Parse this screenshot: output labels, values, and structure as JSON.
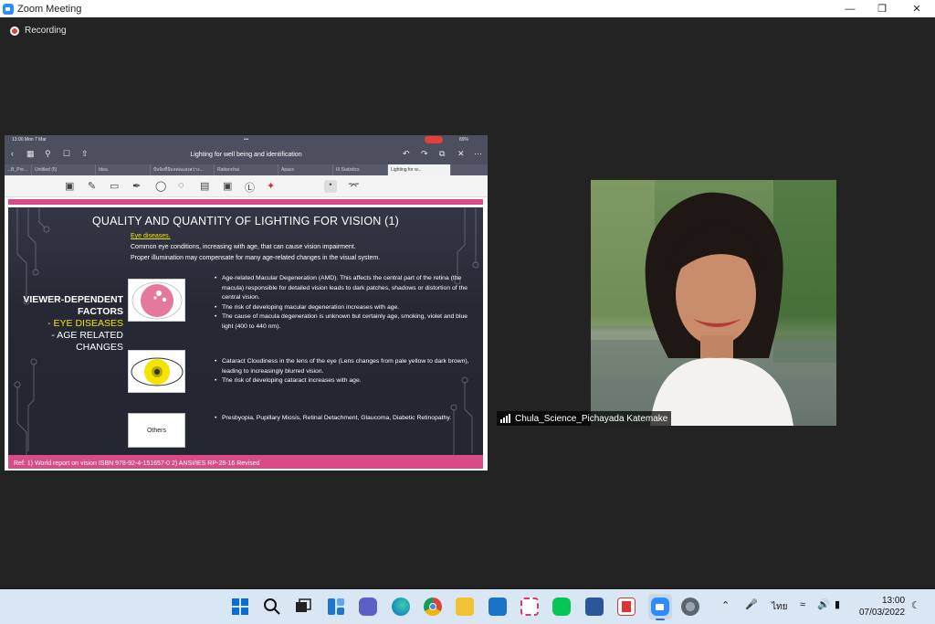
{
  "window": {
    "title": "Zoom Meeting",
    "controls": [
      "minimize-icon",
      "maximize-icon",
      "close-icon"
    ]
  },
  "recording": {
    "label": "Recording"
  },
  "ipad": {
    "status_left": "13:00   Mon 7 Mar",
    "status_right": "89%",
    "doc_title": "Lighting for well being and identification",
    "tabs": [
      "...B_Pre...",
      "Untitled (5)",
      "Idea",
      "ปัจจัยที่มีผลต่อแสงสว่าง...",
      "Rattanchai",
      "Apace",
      "III Statistics",
      "Lighting for w..."
    ]
  },
  "slide": {
    "title": "QUALITY AND QUANTITY OF LIGHTING FOR VISION (1)",
    "subhead": "Eye diseases.",
    "intro1": "Common eye conditions, increasing with age, that can cause vision impairment.",
    "intro2": "Proper illumination may compensate for many age-related changes in the visual system.",
    "left": {
      "line1": "VIEWER-DEPENDENT",
      "line2": "FACTORS",
      "line3": "- EYE DISEASES",
      "line4": "- AGE RELATED",
      "line5": "CHANGES"
    },
    "bullets1": [
      "Age-related Macular Degeneration (AMD). This affects the central part of the retina (the macula) responsible for detailed vision leads to dark patches, shadows or distortion of the central vision.",
      "The risk of developing macular degeneration increases with age.",
      "The cause of macula degeneration is unknown but certainly age, smoking, violet and blue light (400 to 440 nm)."
    ],
    "bullets2": [
      "Cataract Cloudiness in the lens of the eye (Lens changes from pale yellow to dark brown), leading to increasingly blurred vision.",
      "The risk of developing cataract increases with age."
    ],
    "others_label": "Others",
    "bullets3": [
      "Presbyopia, Pupillary Miosis, Retinal Detachment, Glaucoma, Diabetic Retinopathy."
    ],
    "ref": "Ref: 1) World report on vision ISBN 978-92-4-151657-0   2)  ANSI/IES RP-28-16 Revised"
  },
  "participant": {
    "name": "Chula_Science_Pichayada Katemake"
  },
  "taskbar": {
    "icons": [
      "windows-start-icon",
      "search-icon",
      "task-view-icon",
      "widgets-icon",
      "teams-chat-icon",
      "edge-icon",
      "chrome-icon",
      "file-explorer-icon",
      "mail-icon",
      "snipping-tool-icon",
      "line-icon",
      "word-icon",
      "acrobat-icon",
      "zoom-icon",
      "settings-icon"
    ],
    "lang": "ไทย",
    "time": "13:00",
    "date": "07/03/2022"
  },
  "colors": {
    "slide_pink": "#d84b86",
    "slide_yellow": "#f2e400",
    "taskbar": "#d9e6f3",
    "zoom_blue": "#2d8cff"
  }
}
